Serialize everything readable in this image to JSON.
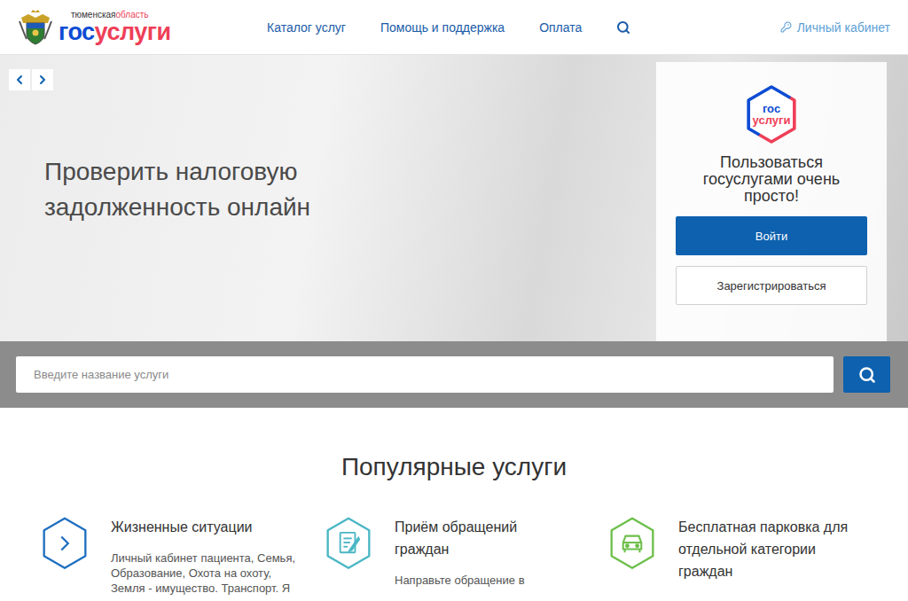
{
  "header": {
    "region": "тюменская",
    "region_suffix": "область",
    "logo_left": "гос",
    "logo_right": "услуги",
    "nav": [
      "Каталог услуг",
      "Помощь и поддержка",
      "Оплата"
    ],
    "account": "Личный кабинет"
  },
  "hero": {
    "headline": "Проверить налоговую задолженность онлайн",
    "panel": {
      "logo_top": "гос",
      "logo_bottom": "услуги",
      "text": "Пользоваться госуслугами очень просто!",
      "login": "Войти",
      "register": "Зарегистрироваться"
    }
  },
  "search": {
    "placeholder": "Введите название услуги"
  },
  "popular": {
    "title": "Популярные услуги",
    "items": [
      {
        "kind": "chevron",
        "color": "#1f6fc0",
        "title": "Жизненные ситуации",
        "description": "Личный кабинет пациента, Семья, Образование, Охота на охоту, Земля - имущество. Транспорт. Я"
      },
      {
        "kind": "document",
        "color": "#49b6c4",
        "title": "Приём обращений граждан",
        "description": "Направьте обращение в"
      },
      {
        "kind": "car",
        "color": "#6cbf4a",
        "title": "Бесплатная парковка для отдельной категории граждан",
        "description": ""
      }
    ]
  }
}
